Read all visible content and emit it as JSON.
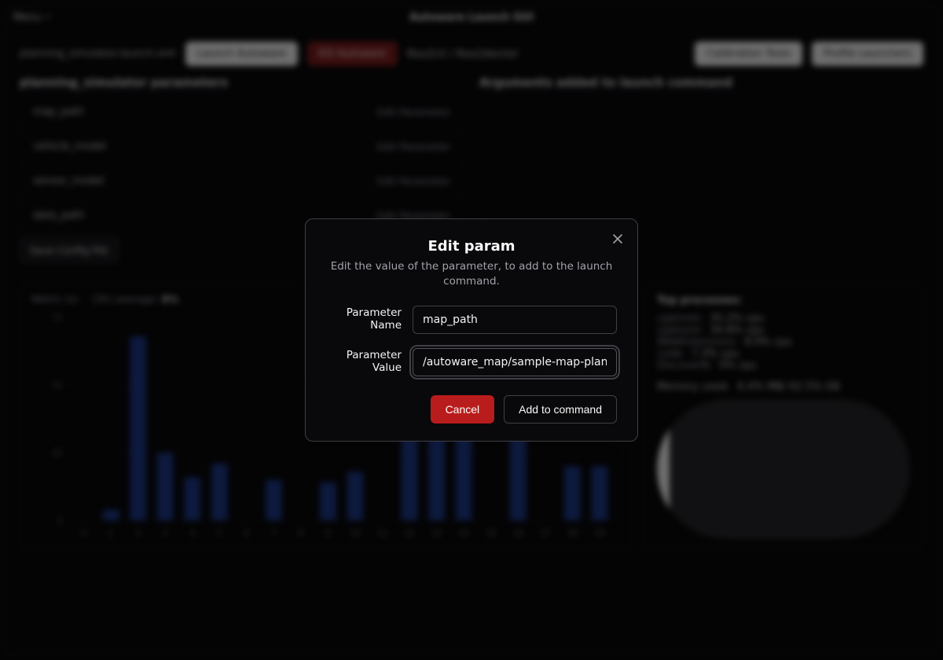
{
  "window": {
    "menu_label": "Menu",
    "title": "Autoware Launch GUI"
  },
  "toolbar": {
    "launch_path": "planning_simulator.launch.xml",
    "launch_label": "Launch Autoware",
    "kill_label": "Kill Autoware",
    "ros2doc_label": "Ros2cli / Ros2doctor",
    "caltools_label": "Calibration Tools",
    "profile_label": "Profile Launchers"
  },
  "params": {
    "section_title": "planning_simulator parameters",
    "edit_label": "Edit Parameter",
    "items": [
      {
        "name": "map_path"
      },
      {
        "name": "vehicle_model"
      },
      {
        "name": "sensor_model"
      },
      {
        "name": "data_path"
      }
    ]
  },
  "args": {
    "section_title": "Arguments added to launch command"
  },
  "save_chip": "Save Config File",
  "chart": {
    "header_metric_label": "Metric (s)",
    "cpu_label": "CPU average:",
    "cpu_value": "8%"
  },
  "chart_data": {
    "type": "bar",
    "categories": [
      "0",
      "1",
      "2",
      "3",
      "4",
      "5",
      "6",
      "7",
      "8",
      "9",
      "10",
      "11",
      "12",
      "13",
      "14",
      "15",
      "16",
      "17",
      "18",
      "19"
    ],
    "values": [
      0,
      4,
      68,
      25,
      16,
      21,
      0,
      15,
      0,
      14,
      18,
      0,
      41,
      40,
      39,
      0,
      32,
      0,
      20,
      20
    ],
    "ylim": [
      0,
      75
    ],
    "yticks": [
      0,
      25,
      50,
      75
    ],
    "xlabel": "",
    "ylabel": ""
  },
  "stats": {
    "header": "Top processes:",
    "rows": [
      {
        "name": "cpptools",
        "pct": "35.2%",
        "unit": "cpu"
      },
      {
        "name": "cpptools",
        "pct": "34.8%",
        "unit": "cpu"
      },
      {
        "name": "WebExtensions",
        "pct": "8.9%",
        "unit": "cpu"
      },
      {
        "name": "code",
        "pct": "7.3%",
        "unit": "cpu"
      },
      {
        "name": "DiscoverN",
        "pct": "5%",
        "unit": "cpu"
      }
    ],
    "mem_label": "Memory used:",
    "mem_value": "6.4% MB/ 62.5% GB",
    "mem_fill_pct": 5
  },
  "modal": {
    "title": "Edit param",
    "description": "Edit the value of the parameter, to add to the launch command.",
    "name_label": "Parameter Name",
    "value_label": "Parameter Value",
    "name_field": "map_path",
    "value_field": "/autoware_map/sample-map-planning",
    "cancel_label": "Cancel",
    "add_label": "Add to command"
  }
}
